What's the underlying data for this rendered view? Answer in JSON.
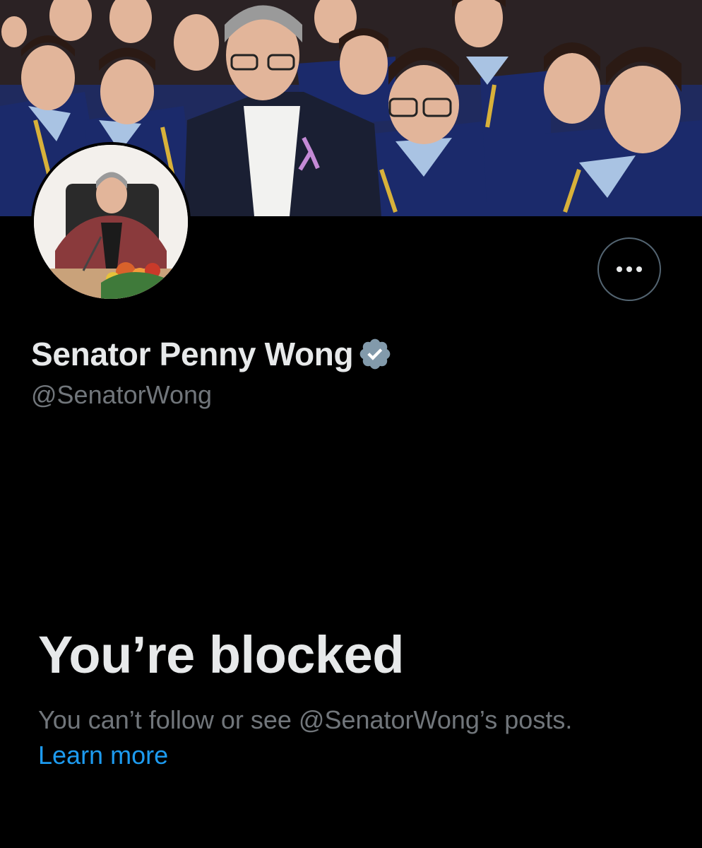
{
  "profile": {
    "display_name": "Senator Penny Wong",
    "handle": "@SenatorWong",
    "verified_badge": "verified-checkmark-icon",
    "banner_image": "banner-photo",
    "avatar_image": "avatar-photo"
  },
  "actions": {
    "more_icon": "more-options-icon"
  },
  "blocked": {
    "title": "You’re blocked",
    "description": "You can’t follow or see @SenatorWong’s posts.",
    "learn_more": "Learn more"
  },
  "colors": {
    "background": "#000000",
    "primary_text": "#e7e9ea",
    "secondary_text": "#71767b",
    "link": "#1d9bf0",
    "verified_badge": "#829aab",
    "button_border": "#536471"
  }
}
